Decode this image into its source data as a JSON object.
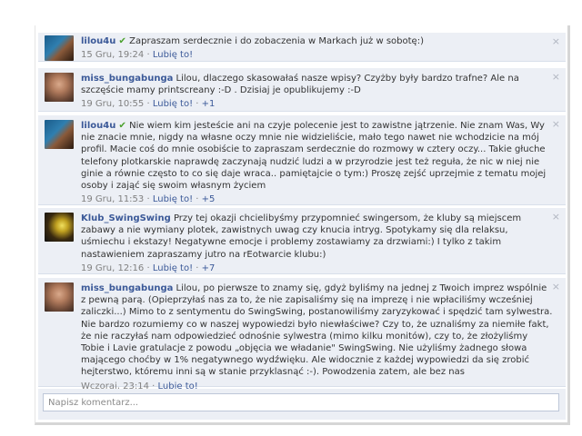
{
  "comments": [
    {
      "author": "lilou4u",
      "verified": true,
      "text": "Zapraszam serdecznie i do zobaczenia w Markach już w sobotę:)",
      "time": "15 Gru, 19:24",
      "like": "Lubię to!",
      "likes": "",
      "avatar": "avatar-lilou4u",
      "close": "×"
    },
    {
      "author": "miss_bungabunga",
      "verified": false,
      "text": "Lilou, dlaczego skasowałaś nasze wpisy? Czyżby były bardzo trafne? Ale na szczęście mamy printscreany :-D . Dzisiaj je opublikujemy :-D",
      "time": "19 Gru, 10:55",
      "like": "Lubię to!",
      "likes": "+1",
      "avatar": "avatar-miss-bungabunga",
      "close": "×"
    },
    {
      "author": "lilou4u",
      "verified": true,
      "text": "Nie wiem kim jesteście ani na czyje polecenie jest to zawistne jątrzenie. Nie znam Was, Wy nie znacie mnie, nigdy na własne oczy mnie nie widzieliście, mało tego nawet nie wchodzicie na mój profil. Macie coś do mnie osobiście to zapraszam serdecznie do rozmowy w cztery oczy... Takie głuche telefony plotkarskie naprawdę zaczynają nudzić ludzi a w przyrodzie jest też reguła, że nic w niej nie ginie a równie często to co się daje wraca.. pamiętajcie o tym:) Proszę zejść uprzejmie z tematu mojej osoby i zająć się swoim własnym życiem",
      "time": "19 Gru, 11:53",
      "like": "Lubię to!",
      "likes": "+5",
      "avatar": "avatar-lilou4u",
      "close": "×"
    },
    {
      "author": "Klub_SwingSwing",
      "verified": false,
      "text": "Przy tej okazji chcielibyśmy przypomnieć swingersom, że kluby są miejscem zabawy a nie wymiany plotek, zawistnych uwag czy knucia intryg. Spotykamy się dla relaksu, uśmiechu i ekstazy! Negatywne emocje i problemy zostawiamy za drzwiami:) I tylko z takim nastawieniem zapraszamy jutro na rEotwarcie klubu:)",
      "time": "19 Gru, 12:16",
      "like": "Lubię to!",
      "likes": "+7",
      "avatar": "avatar-klub-swingswing",
      "close": "×"
    },
    {
      "author": "miss_bungabunga",
      "verified": false,
      "text": "Lilou, po pierwsze to znamy się, gdyż byliśmy na jednej z Twoich imprez wspólnie z pewną parą. (Opieprzyłaś nas za to, że nie zapisaliśmy się na imprezę i nie wpłaciliśmy wcześniej zaliczki...) Mimo to z sentymentu do SwingSwing, postanowiliśmy zaryzykować i spędzić tam sylwestra. Nie bardzo rozumiemy co w naszej wypowiedzi było niewłaściwe? Czy to, że uznaliśmy za niemiłe fakt, że nie raczyłaś nam odpowiedzieć odnośnie sylwestra (mimo kilku monitów), czy to, że złożyliśmy Tobie i Lavie gratulacje z powodu „objęcia we władanie\" SwingSwing. Nie użyliśmy żadnego słowa mającego choćby w 1% negatywnego wydźwięku. Ale widocznie z każdej wypowiedzi da się zrobić hejterstwo, któremu inni są w stanie przyklasnąć :-). Powodzenia zatem, ale bez nas",
      "time": "Wczoraj, 23:14",
      "like": "Lubię to!",
      "likes": "",
      "avatar": "avatar-miss-bungabunga",
      "close": "×"
    }
  ],
  "composer": {
    "placeholder": "Napisz komentarz..."
  },
  "colors": {
    "comment_bg": "#eceff5",
    "link": "#3b5998",
    "check": "#4aa02c"
  }
}
